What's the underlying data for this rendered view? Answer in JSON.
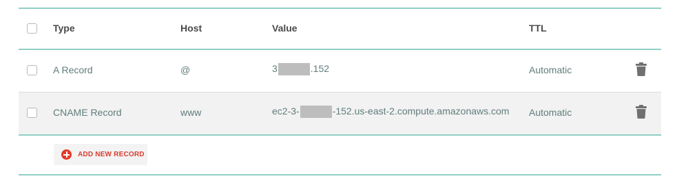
{
  "table": {
    "columns": {
      "type": "Type",
      "host": "Host",
      "value": "Value",
      "ttl": "TTL"
    },
    "rows": [
      {
        "type": "A Record",
        "host": "@",
        "value_prefix": "3",
        "value_suffix": ".152",
        "ttl": "Automatic"
      },
      {
        "type": "CNAME Record",
        "host": "www",
        "value_prefix": "ec2-3-",
        "value_suffix": "-152.us-east-2.compute.amazonaws.com",
        "ttl": "Automatic"
      }
    ]
  },
  "actions": {
    "add_record_label": "ADD NEW RECORD"
  },
  "icons": {
    "delete": "trash-icon",
    "add": "plus-circle-icon"
  },
  "colors": {
    "rule": "#8fcfc4",
    "accent": "#e3392a",
    "text": "#5f7d7a"
  }
}
